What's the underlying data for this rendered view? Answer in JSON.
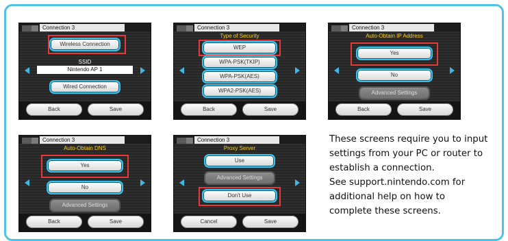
{
  "panel1": {
    "title": "Connection 3",
    "button_wireless": "Wireless Connection",
    "ssid_label": "SSID",
    "ssid_value": "Nintendo AP 1",
    "button_wired": "Wired Connection",
    "back": "Back",
    "save": "Save"
  },
  "panel2": {
    "title": "Connection 3",
    "heading": "Type of Security",
    "options": [
      "WEP",
      "WPA-PSK(TKIP)",
      "WPA-PSK(AES)",
      "WPA2-PSK(AES)"
    ],
    "back": "Back",
    "save": "Save"
  },
  "panel3": {
    "title": "Connection 3",
    "heading": "Auto-Obtain IP Address",
    "yes": "Yes",
    "no": "No",
    "advanced": "Advanced Settings",
    "back": "Back",
    "save": "Save"
  },
  "panel4": {
    "title": "Connection 3",
    "heading": "Auto-Obtain DNS",
    "yes": "Yes",
    "no": "No",
    "advanced": "Advanced Settings",
    "back": "Back",
    "save": "Save"
  },
  "panel5": {
    "title": "Connection 3",
    "heading": "Proxy Server",
    "use": "Use",
    "advanced": "Advanced Settings",
    "dont_use": "Don't Use",
    "cancel": "Cancel",
    "save": "Save"
  },
  "caption": {
    "lines": [
      "These screens require you to input",
      "settings from your PC or router to",
      "establish a connection.",
      "See support.nintendo.com for",
      "additional help on how to",
      "complete these screens."
    ]
  },
  "colors": {
    "accent": "#4fc3e6",
    "selection": "#e63a3a",
    "heading": "#ffd21a"
  }
}
